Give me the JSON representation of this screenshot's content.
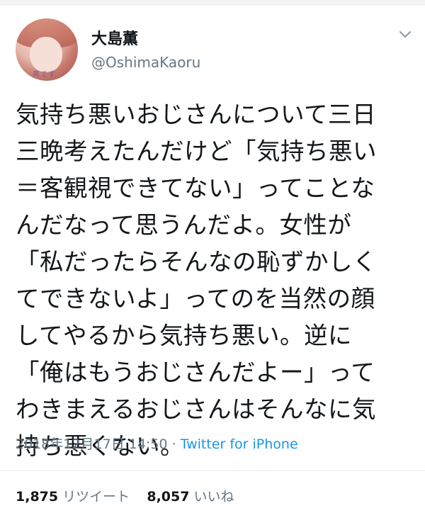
{
  "user": {
    "display_name": "大島薫",
    "handle": "@OshimaKaoru",
    "avatar_caption": "男です"
  },
  "menu_icon": "chevron-down-icon",
  "tweet": {
    "lines": [
      "気持ち悪いおじさんについて三日",
      "三晩考えたんだけど「気持ち悪い",
      "＝客観視できてない」ってことな",
      "んだなって思うんだよ。女性が",
      "「私だったらそんなの恥ずかしく",
      "てできないよ」ってのを当然の顔",
      "してやるから気持ち悪い。逆に",
      "「俺はもうおじさんだよー」って",
      "わきまえるおじさんはそんなに気",
      "持ち悪くない。"
    ]
  },
  "meta": {
    "timestamp": "2018年12月17日 14:50",
    "separator": " · ",
    "source": "Twitter for iPhone"
  },
  "stats": {
    "retweets": {
      "count": "1,875",
      "label": "リツイート"
    },
    "likes": {
      "count": "8,057",
      "label": "いいね"
    }
  },
  "colors": {
    "text": "#14171a",
    "muted": "#657786",
    "link": "#1b95e0",
    "divider": "#e6ecf0"
  }
}
